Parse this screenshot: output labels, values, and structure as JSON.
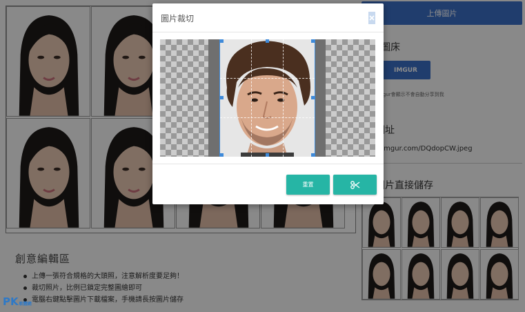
{
  "modal": {
    "title": "圖片裁切",
    "close_icon": "close-icon",
    "reset_label": "重置",
    "crop_icon": "scissors-icon"
  },
  "editor": {
    "title": "創意編輯區",
    "items": [
      "上傳一張符合規格的大頭照，注意解析度要足夠！",
      "裁切照片，比例已鎖定完整圖繪即可",
      "電腦右鍵點擊圖片下載檔案，手機請長按圖片儲存"
    ]
  },
  "sidebar": {
    "upload_label": "上傳圖片",
    "hosting_title": "圖床",
    "imgur_label": "IMGUR",
    "imgur_note": "Imgur會顯示不會自動分享到我",
    "url_title": "網址",
    "url_value": "/i.imgur.com/DQdopCW.jpeg",
    "save_title": "圖片直接儲存"
  },
  "watermark": {
    "text": "PK",
    "sub": "軟體網"
  },
  "colors": {
    "primary": "#3b6fc6",
    "teal": "#26b5a5",
    "crop_border": "#3f8ad9",
    "watermark": "#2e79c7"
  }
}
